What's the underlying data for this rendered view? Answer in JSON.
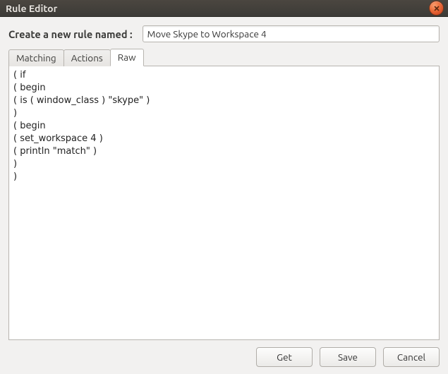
{
  "titlebar": {
    "title": "Rule Editor"
  },
  "prompt": "Create a new rule named :",
  "rule_name": "Move Skype to Workspace 4",
  "tabs": [
    {
      "label": "Matching",
      "active": false
    },
    {
      "label": "Actions",
      "active": false
    },
    {
      "label": "Raw",
      "active": true
    }
  ],
  "code": "( if\n( begin\n( is ( window_class ) \"skype\" )\n)\n( begin\n( set_workspace 4 )\n( println \"match\" )\n)\n)\n",
  "buttons": {
    "get": "Get",
    "save": "Save",
    "cancel": "Cancel"
  }
}
